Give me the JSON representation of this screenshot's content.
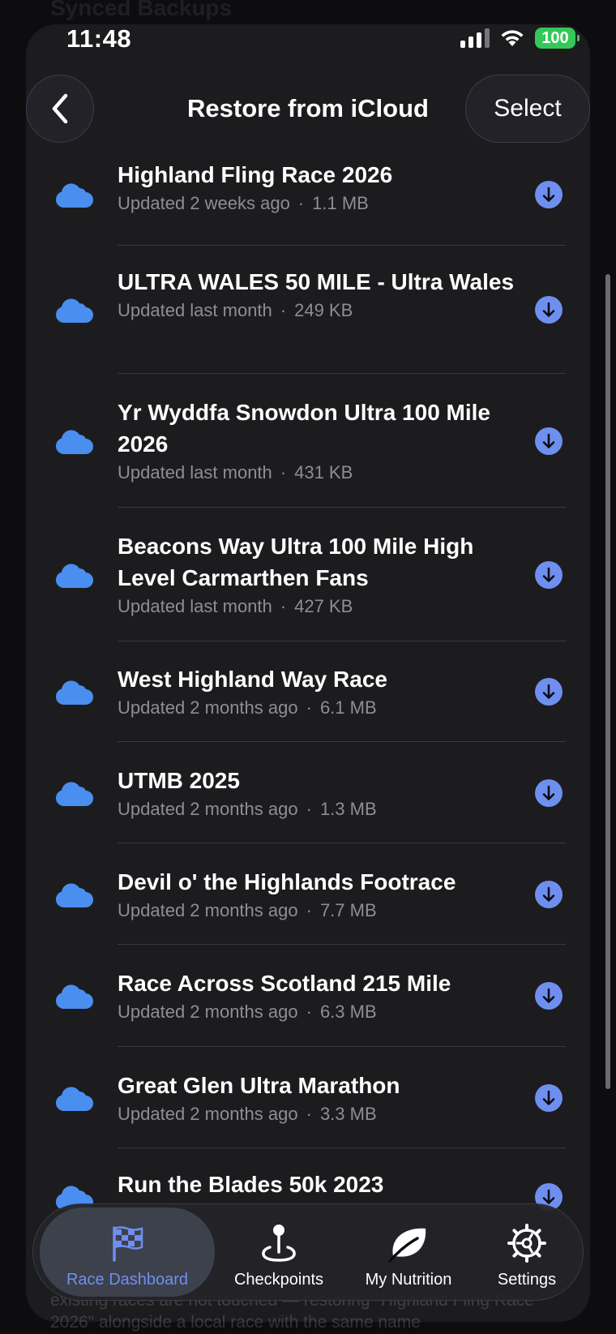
{
  "status": {
    "time": "11:48",
    "battery": "100"
  },
  "background": {
    "top_text": "Synced Backups",
    "bottom_text": "existing races are not touched — restoring \"Highland Fling Race 2026\" alongside a local race with the same name"
  },
  "nav": {
    "back_icon": "chevron-left-icon",
    "title": "Restore from iCloud",
    "select_label": "Select"
  },
  "items": [
    {
      "title": "Highland Fling Race 2026",
      "updated": "Updated 2 weeks ago",
      "size": "1.1 MB"
    },
    {
      "title": "ULTRA WALES 50 MILE - Ultra Wales",
      "updated": "Updated last month",
      "size": "249 KB"
    },
    {
      "title": "Yr Wyddfa Snowdon Ultra 100 Mile 2026",
      "updated": "Updated last month",
      "size": "431 KB"
    },
    {
      "title": "Beacons Way Ultra 100 Mile High Level Carmarthen Fans",
      "updated": "Updated last month",
      "size": "427 KB"
    },
    {
      "title": "West Highland Way Race",
      "updated": "Updated 2 months ago",
      "size": "6.1 MB"
    },
    {
      "title": "UTMB 2025",
      "updated": "Updated 2 months ago",
      "size": "1.3 MB"
    },
    {
      "title": "Devil o' the Highlands Footrace",
      "updated": "Updated 2 months ago",
      "size": "7.7 MB"
    },
    {
      "title": "Race Across Scotland 215 Mile",
      "updated": "Updated 2 months ago",
      "size": "6.3 MB"
    },
    {
      "title": "Great Glen Ultra Marathon",
      "updated": "Updated 2 months ago",
      "size": "3.3 MB"
    },
    {
      "title": "Run the Blades 50k 2023",
      "updated": "",
      "size": ""
    }
  ],
  "separator": "·",
  "tabs": [
    {
      "label": "Race Dashboard",
      "icon": "checkered-flag-icon",
      "active": true
    },
    {
      "label": "Checkpoints",
      "icon": "map-pin-icon",
      "active": false
    },
    {
      "label": "My Nutrition",
      "icon": "leaf-icon",
      "active": false
    },
    {
      "label": "Settings",
      "icon": "gear-icon",
      "active": false
    }
  ],
  "colors": {
    "accent": "#6f8ff0",
    "cloud": "#4a8ef0",
    "battery": "#34c759",
    "sheet": "#1c1c1e",
    "secondary_text": "#8e8e93"
  }
}
